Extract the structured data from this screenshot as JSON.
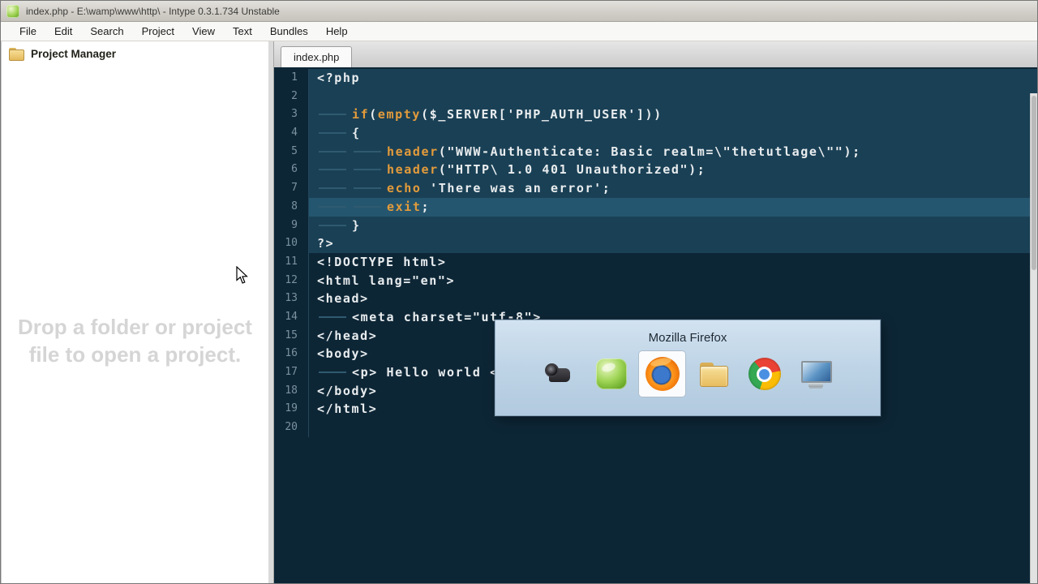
{
  "window": {
    "title": "index.php - E:\\wamp\\www\\http\\ - Intype 0.3.1.734 Unstable"
  },
  "menu": {
    "items": [
      "File",
      "Edit",
      "Search",
      "Project",
      "View",
      "Text",
      "Bundles",
      "Help"
    ]
  },
  "sidebar": {
    "header": "Project Manager",
    "placeholder": "Drop a folder or project file to open a project."
  },
  "tabs": [
    {
      "label": "index.php",
      "active": true
    }
  ],
  "editor": {
    "selection_lines": [
      1,
      10
    ],
    "current_line": 8,
    "lines": [
      {
        "n": 1,
        "indent": 0,
        "segments": [
          {
            "c": "plain",
            "t": "<?php"
          }
        ]
      },
      {
        "n": 2,
        "indent": 0,
        "segments": []
      },
      {
        "n": 3,
        "indent": 1,
        "segments": [
          {
            "c": "kw",
            "t": "if"
          },
          {
            "c": "plain",
            "t": "("
          },
          {
            "c": "kw",
            "t": "empty"
          },
          {
            "c": "plain",
            "t": "($_SERVER['PHP_AUTH_USER']))"
          }
        ]
      },
      {
        "n": 4,
        "indent": 1,
        "segments": [
          {
            "c": "plain",
            "t": "{"
          }
        ]
      },
      {
        "n": 5,
        "indent": 2,
        "segments": [
          {
            "c": "kw",
            "t": "header"
          },
          {
            "c": "plain",
            "t": "(\"WWW-Authenticate: Basic realm=\\\"thetutlage\\\"\");"
          }
        ]
      },
      {
        "n": 6,
        "indent": 2,
        "segments": [
          {
            "c": "kw",
            "t": "header"
          },
          {
            "c": "plain",
            "t": "(\"HTTP\\ 1.0 401 Unauthorized\");"
          }
        ]
      },
      {
        "n": 7,
        "indent": 2,
        "segments": [
          {
            "c": "kw",
            "t": "echo"
          },
          {
            "c": "plain",
            "t": " 'There was an error';"
          }
        ]
      },
      {
        "n": 8,
        "indent": 2,
        "segments": [
          {
            "c": "kw",
            "t": "exit"
          },
          {
            "c": "plain",
            "t": ";"
          }
        ]
      },
      {
        "n": 9,
        "indent": 1,
        "segments": [
          {
            "c": "plain",
            "t": "}"
          }
        ]
      },
      {
        "n": 10,
        "indent": 0,
        "segments": [
          {
            "c": "plain",
            "t": "?>"
          }
        ]
      },
      {
        "n": 11,
        "indent": 0,
        "segments": [
          {
            "c": "plain",
            "t": "<!DOCTYPE html>"
          }
        ]
      },
      {
        "n": 12,
        "indent": 0,
        "segments": [
          {
            "c": "plain",
            "t": "<html lang=\"en\">"
          }
        ]
      },
      {
        "n": 13,
        "indent": 0,
        "segments": [
          {
            "c": "plain",
            "t": "<head>"
          }
        ]
      },
      {
        "n": 14,
        "indent": 1,
        "segments": [
          {
            "c": "plain",
            "t": "<meta charset=\"utf-8\">"
          }
        ]
      },
      {
        "n": 15,
        "indent": 0,
        "segments": [
          {
            "c": "plain",
            "t": "</head>"
          }
        ]
      },
      {
        "n": 16,
        "indent": 0,
        "segments": [
          {
            "c": "plain",
            "t": "<body>"
          }
        ]
      },
      {
        "n": 17,
        "indent": 1,
        "segments": [
          {
            "c": "plain",
            "t": "<p> Hello world <"
          }
        ]
      },
      {
        "n": 18,
        "indent": 0,
        "segments": [
          {
            "c": "plain",
            "t": "</body>"
          }
        ]
      },
      {
        "n": 19,
        "indent": 0,
        "segments": [
          {
            "c": "plain",
            "t": "</html>"
          }
        ]
      },
      {
        "n": 20,
        "indent": 0,
        "segments": []
      }
    ]
  },
  "overlay": {
    "title": "Mozilla Firefox",
    "selected_index": 2,
    "icons": [
      {
        "name": "camcorder-icon"
      },
      {
        "name": "intype-icon"
      },
      {
        "name": "firefox-icon"
      },
      {
        "name": "folder-icon"
      },
      {
        "name": "chrome-icon"
      },
      {
        "name": "desktop-icon"
      }
    ]
  },
  "colors": {
    "editor_bg": "#0d2636",
    "selection_bg": "#1a4055",
    "current_line_bg": "#25566f",
    "keyword": "#e39b3b",
    "code_plain": "#e9edef",
    "gutter_text": "#7b929f",
    "indent_guide": "#2f5a70"
  }
}
